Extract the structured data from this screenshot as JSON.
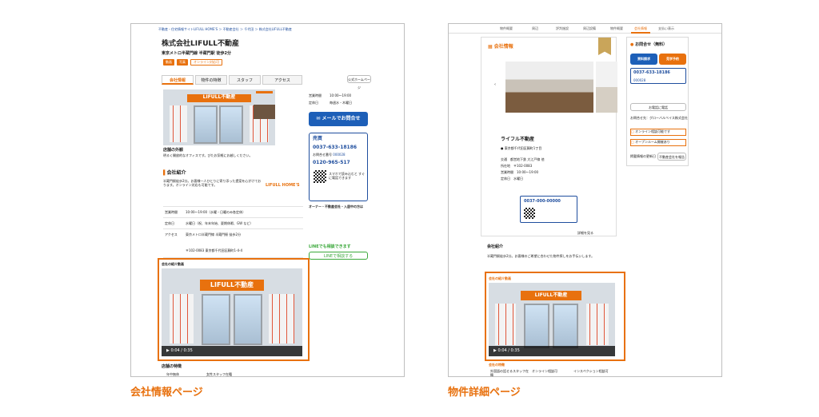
{
  "captions": {
    "left": "会社情報ページ",
    "right": "物件詳細ページ"
  },
  "left_page": {
    "breadcrumb": "不動産・住宅情報サイトLIFULL HOME'S ＞ 不動産会社 ＞ 千代田 ＞ 株式会社LIFULL不動産",
    "company_name": "株式会社LIFULL不動産",
    "access": "東京メトロ半蔵門線 半蔵門駅 徒歩2分",
    "badges": [
      "動画",
      "写真",
      "オンライン対応可"
    ],
    "tabs": [
      "会社情報",
      "物件の特徴",
      "スタッフ",
      "アクセス"
    ],
    "homepage_button": "公式ホームページ",
    "sign_text": "LIFULL不動産",
    "photo_caption": "店舗の外観",
    "photo_description": "明るく開放的なオフィスです。びたお気軽にお越しください。",
    "section_intro": "会社紹介",
    "intro_text": "半蔵門駅徒歩2分。お客様一人ひとりに寄り添った提案を心がけております。オンライン対応も可能です。",
    "info_rows": [
      {
        "label": "営業時間",
        "value": "10:00〜19:00（水曜・日曜のみ各定休）"
      },
      {
        "label": "定休日",
        "value": "水曜日（祝、年末年始、夏期休暇、GW など）"
      },
      {
        "label": "アクセス",
        "value": "東京メトロ半蔵門線 半蔵門駅 徒歩2分"
      }
    ],
    "address": "〒102-0083 東京都千代田区麹町1-4-4",
    "hours_label": "営業時間",
    "hours_value": "10:00〜19:00",
    "holiday_label": "定休日",
    "holiday_value": "毎週水・木曜日",
    "mail_button": "メールでお問合せ",
    "free_label": "無料",
    "phone_title": "売買",
    "phone_number": "0037-633-18186",
    "phone_number2": "0120-965-517",
    "phone_note": "お問合せ番号",
    "phone_code": "000028",
    "qr_text": "スマホで読み込むと すぐに電話できます",
    "lifull_logo": "LIFULL HOME'S",
    "owner_title": "オーナー・不動産会社・入居中の方は",
    "line_title": "LINEでも相談できます",
    "line_button": "LINEで相談する",
    "video_title": "会社の紹介動画",
    "video_time": "0:04 / 0:35",
    "features_title": "店舗の特徴",
    "feature_tags": [
      "年中無休",
      "女性スタッフ在籍"
    ]
  },
  "right_page": {
    "nav": [
      "物件概要",
      "周辺",
      "評判施設",
      "周辺設備",
      "物件概要",
      "会社情報",
      "支払い表示"
    ],
    "section_title": "会社情報",
    "company_name": "ライフル不動産",
    "address": "東京都千代田区麹町1丁目",
    "details": [
      {
        "label": "交通",
        "value": "都営地下鉄 大江戸線 他"
      },
      {
        "label": "所在地",
        "value": "〒102-0083"
      },
      {
        "label": "営業時間",
        "value": "10:00〜19:00"
      },
      {
        "label": "定休日",
        "value": "水曜日"
      }
    ],
    "phone_number": "0037-000-00000",
    "more_link": "詳細を見る",
    "intro_title": "会社紹介",
    "intro_text": "半蔵門駅徒歩2分。お客様のご希望に合わせた物件探しをお手伝いします。",
    "video_title": "会社の紹介動画",
    "sign_text": "LIFULL不動産",
    "video_time": "0:04 / 0:35",
    "features_title": "会社の特徴",
    "feature_tags": [
      "外国語の話せるスタッフ在籍",
      "オンライン相談可",
      "インスペクション相談可"
    ],
    "sidebar": {
      "inquiry_title": "お問合せ（無料）",
      "doc_button": "資料請求",
      "visit_button": "見学予約",
      "phone": "0037-633-18186",
      "phone_code": "000028",
      "callback_button": "お電話に電話",
      "company_label": "お問合せ先",
      "company_value": "グローバルベイス株式会社",
      "options": [
        "オンライン相談可能です",
        "オープンルーム開催あり"
      ],
      "note": "掲載情報の更新日",
      "report_button": "不動産会社を報告"
    }
  }
}
